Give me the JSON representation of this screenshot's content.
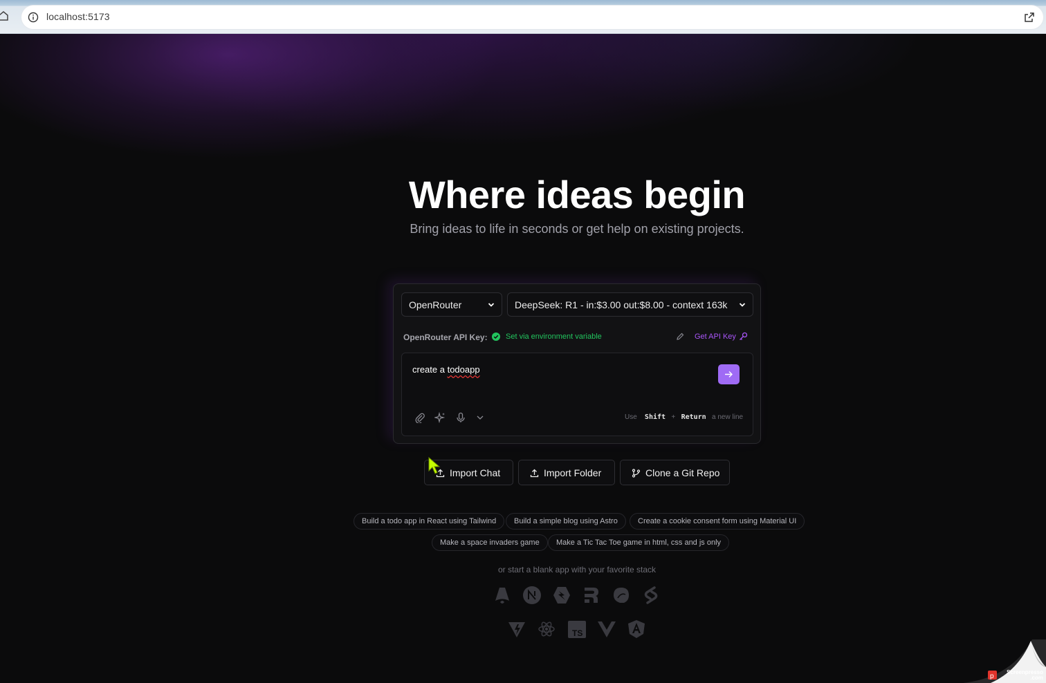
{
  "browser": {
    "url": "localhost:5173",
    "icons": [
      "home-icon",
      "info-icon",
      "open-external-icon"
    ]
  },
  "hero": {
    "title": "Where ideas begin",
    "subtitle": "Bring ideas to life in seconds or get help on existing projects."
  },
  "chat": {
    "provider": "OpenRouter",
    "model": "DeepSeek: R1 - in:$3.00 out:$8.00 - context 163k",
    "api_key_label": "OpenRouter API Key:",
    "api_key_status": "Set via environment variable",
    "get_api_key": "Get API Key",
    "prompt_before": "create a ",
    "prompt_misspelled": "todoapp",
    "hint_use": "Use",
    "hint_shift": "Shift",
    "hint_plus": "+",
    "hint_return": "Return",
    "hint_newline": "a new line",
    "colors": {
      "accent": "#9f6bf5",
      "status_ok": "#22c55e",
      "link": "#a855f7"
    }
  },
  "actions": {
    "import_chat": "Import Chat",
    "import_folder": "Import Folder",
    "clone_repo": "Clone a Git Repo"
  },
  "examples": [
    "Build a todo app in React using Tailwind",
    "Build a simple blog using Astro",
    "Create a cookie consent form using Material UI",
    "Make a space invaders game",
    "Make a Tic Tac Toe game in html, css and js only"
  ],
  "starter": {
    "text": "or start a blank app with your favorite stack",
    "templates": [
      "astro-icon",
      "nextjs-icon",
      "qwik-icon",
      "remix-icon",
      "slidev-icon",
      "svelte-icon",
      "vite-icon",
      "react-icon",
      "typescript-icon",
      "vue-icon",
      "angular-icon"
    ],
    "ts_label": "TS"
  },
  "watermark": {
    "line1": "Screenpresso",
    "line2": ".com"
  }
}
